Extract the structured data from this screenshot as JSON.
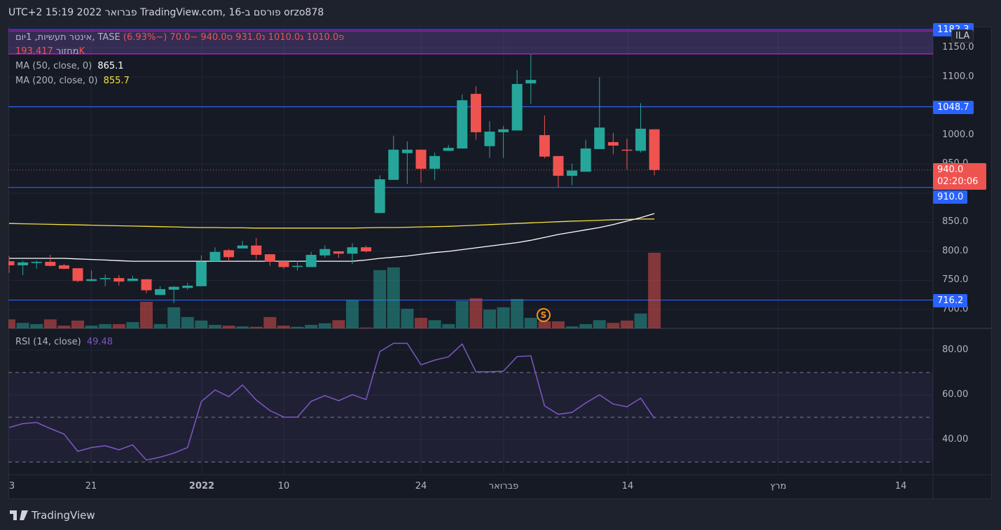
{
  "title": "orzo878 פורסם ב-TradingView.com, 16 פברואר 2022 15:19 UTC+2",
  "legend": {
    "symbol": "אינטר תעשיות, 1יום, TASE",
    "open_label": "פ",
    "open": "1010.0",
    "high_label": "ג",
    "high": "1010.0",
    "low_label": "נ",
    "low": "931.0",
    "close_label": "ס",
    "close": "940.0",
    "change": "−70.0 (−6.93%)",
    "volume_label": "מחזור",
    "volume": "193.417K",
    "ma50_label": "MA (50, close, 0)",
    "ma50_value": "865.1",
    "ma200_label": "MA (200, close, 0)",
    "ma200_value": "855.7",
    "rsi_label": "RSI (14, close)",
    "rsi_value": "49.48"
  },
  "currency_badge": "ILA",
  "event_badge": "S",
  "price_axis": [
    "1150.0",
    "1100.0",
    "1000.0",
    "950.0",
    "850.0",
    "800.0",
    "750.0",
    "700.0"
  ],
  "price_tags": {
    "top": "1182.3",
    "upper_line": "1048.7",
    "last": "940.0",
    "countdown": "02:20:06",
    "lower_line": "910.0",
    "bottom_line": "716.2"
  },
  "rsi_axis": [
    "80.00",
    "60.00",
    "40.00"
  ],
  "time_axis": [
    {
      "label": "3",
      "bold": false
    },
    {
      "label": "21",
      "bold": false
    },
    {
      "label": "2022",
      "bold": true
    },
    {
      "label": "10",
      "bold": false
    },
    {
      "label": "24",
      "bold": false
    },
    {
      "label": "פברואר",
      "bold": false
    },
    {
      "label": "14",
      "bold": false
    },
    {
      "label": "מרץ",
      "bold": false
    },
    {
      "label": "14",
      "bold": false
    }
  ],
  "brand": "TradingView",
  "colors": {
    "up": "#26a69a",
    "down": "#ef5350",
    "ma50": "#ffffff",
    "ma200": "#f5e13b",
    "rsi": "#7e57c2",
    "hline": "#2962ff",
    "band": "#7e57c2"
  },
  "chart_data": {
    "type": "candlestick",
    "price_ylim": [
      680,
      1185
    ],
    "hlines": [
      1182.3,
      1048.7,
      910.0,
      716.2
    ],
    "ohlc": [
      [
        783,
        792,
        763,
        776
      ],
      [
        776,
        784,
        759,
        781
      ],
      [
        780,
        784,
        770,
        782
      ],
      [
        782,
        794,
        774,
        775
      ],
      [
        776,
        778,
        769,
        770
      ],
      [
        771,
        771,
        747,
        749
      ],
      [
        749,
        767,
        749,
        752
      ],
      [
        752,
        760,
        740,
        754
      ],
      [
        754,
        759,
        741,
        748
      ],
      [
        749,
        758,
        749,
        753
      ],
      [
        752,
        752,
        728,
        733
      ],
      [
        725,
        740,
        725,
        735
      ],
      [
        734,
        740,
        711,
        739
      ],
      [
        737,
        746,
        734,
        741
      ],
      [
        740,
        793,
        740,
        782
      ],
      [
        783,
        807,
        783,
        799
      ],
      [
        802,
        804,
        783,
        790
      ],
      [
        805,
        818,
        805,
        810
      ],
      [
        810,
        823,
        786,
        794
      ],
      [
        795,
        795,
        775,
        782
      ],
      [
        783,
        783,
        770,
        773
      ],
      [
        774,
        784,
        767,
        775
      ],
      [
        773,
        799,
        773,
        794
      ],
      [
        793,
        810,
        789,
        804
      ],
      [
        800,
        800,
        789,
        796
      ],
      [
        796,
        814,
        778,
        807
      ],
      [
        807,
        810,
        798,
        800
      ],
      [
        866,
        931,
        866,
        924
      ],
      [
        923,
        999,
        923,
        975
      ],
      [
        969,
        989,
        916,
        975
      ],
      [
        975,
        975,
        918,
        942
      ],
      [
        942,
        970,
        923,
        964
      ],
      [
        973,
        983,
        973,
        978
      ],
      [
        977,
        1070,
        977,
        1060
      ],
      [
        1071,
        1084,
        992,
        1005
      ],
      [
        981,
        1024,
        961,
        1006
      ],
      [
        1005,
        1016,
        961,
        1010
      ],
      [
        1008,
        1112,
        1008,
        1088
      ],
      [
        1089,
        1139,
        1054,
        1095
      ],
      [
        1000,
        1034,
        960,
        963
      ],
      [
        964,
        964,
        910,
        930
      ],
      [
        930,
        951,
        914,
        939
      ],
      [
        937,
        992,
        937,
        977
      ],
      [
        976,
        1100,
        976,
        1013
      ],
      [
        988,
        1004,
        967,
        982
      ],
      [
        975,
        994,
        941,
        974
      ],
      [
        973,
        1055,
        970,
        1011
      ],
      [
        1010,
        1010,
        931,
        940
      ]
    ],
    "volume_k": [
      23,
      14,
      11,
      23,
      7,
      20,
      7,
      11,
      11,
      16,
      68,
      11,
      54,
      29,
      20,
      9,
      7,
      5,
      4,
      29,
      7,
      4,
      9,
      13,
      21,
      72,
      2,
      149,
      156,
      50,
      27,
      21,
      11,
      70,
      77,
      48,
      54,
      75,
      27,
      18,
      18,
      5,
      11,
      21,
      14,
      20,
      38,
      193.417
    ],
    "ma50": [
      788,
      788,
      788,
      788,
      788,
      787,
      786,
      785,
      784,
      783,
      783,
      783,
      783,
      783,
      783,
      783,
      783,
      783,
      783,
      783,
      783,
      783,
      783,
      783,
      783,
      783,
      785,
      788,
      790,
      792,
      795,
      798,
      800,
      803,
      806,
      809,
      812,
      815,
      819,
      824,
      829,
      833,
      837,
      841,
      846,
      852,
      858,
      865.1
    ],
    "ma200": [
      848,
      847.5,
      847,
      846.5,
      846,
      845.5,
      845,
      844.5,
      844,
      843.5,
      843,
      842.5,
      842,
      841.5,
      841,
      841,
      840.5,
      840.5,
      840,
      840,
      840,
      840,
      840,
      840,
      840,
      840,
      840.5,
      841,
      841,
      841.5,
      842,
      842.5,
      843,
      844,
      845,
      846,
      847,
      848,
      849,
      850,
      851,
      852,
      852.5,
      853.5,
      854.5,
      855,
      855.5,
      855.7
    ],
    "rsi": [
      45.4,
      47.2,
      47.7,
      45,
      42.5,
      34.8,
      36.5,
      37.3,
      35.5,
      37.7,
      30.9,
      32.2,
      34,
      36.5,
      57,
      62.2,
      59.2,
      64.4,
      57.7,
      53,
      50.1,
      50.1,
      57.1,
      59.7,
      57.4,
      60.1,
      57.9,
      79.3,
      83,
      83,
      73.4,
      75.5,
      77,
      82.7,
      70.3,
      70.3,
      70.6,
      77.1,
      77.4,
      55.1,
      51.3,
      52.2,
      56.4,
      60,
      55.9,
      54.7,
      58.5,
      49.48
    ],
    "rsi_levels": [
      70,
      50,
      30
    ],
    "rsi_ylim": [
      25,
      89
    ]
  }
}
